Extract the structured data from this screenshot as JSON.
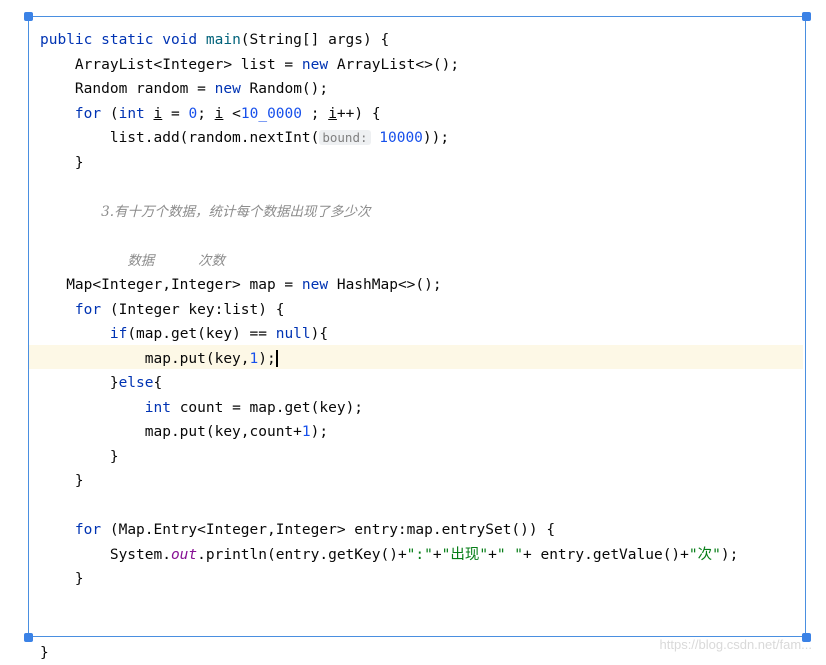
{
  "code": {
    "l01": {
      "t1": "public static void ",
      "t2": "main",
      "t3": "(String[] args) {"
    },
    "l02": {
      "t1": "    ArrayList<Integer> list = ",
      "t2": "new",
      " t3": "",
      "t3b": " ArrayList<>();"
    },
    "l03": {
      "t1": "    Random random = ",
      "t2": "new",
      "t3": " Random();"
    },
    "l04": {
      "t1": "    ",
      "t2": "for",
      "t3": " (",
      "t4": "int",
      " t5": "",
      "t5b": " ",
      "t6": "i",
      "t7": " = ",
      "t8": "0",
      "t9": "; ",
      "t10": "i",
      "t11": " <",
      "t12": "10_0000",
      "t13": " ; ",
      "t14": "i",
      "t15": "++) {"
    },
    "l05": {
      "t1": "        list.add(random.nextInt(",
      "hint": "bound:",
      "t2": " ",
      "t3": "10000",
      "t4": "));"
    },
    "l06": {
      "t1": "    }"
    },
    "l08": {
      "comment": "3.有十万个数据，统计每个数据出现了多少次"
    },
    "l10": {
      "c1": "数据",
      "c2": "次数"
    },
    "l11": {
      "t1": "   Map<Integer,Integer> map = ",
      "t2": "new",
      "t3": " HashMap<>();"
    },
    "l12": {
      "t1": "    ",
      "t2": "for",
      "t3": " (Integer key:list) {"
    },
    "l13": {
      "t1": "        ",
      "t2": "if",
      "t3": "(map.get(key) == ",
      "t4": "null",
      "t5": "){"
    },
    "l14": {
      "t1": "            map.put(key,",
      "t2": "1",
      "t3": ");"
    },
    "l15": {
      "t1": "        }",
      "t2": "else",
      "t3": "{"
    },
    "l16": {
      "t1": "            ",
      "t2": "int",
      "t3": " count = map.get(key);"
    },
    "l17": {
      "t1": "            map.put(key,count+",
      "t2": "1",
      "t3": ");"
    },
    "l18": {
      "t1": "        }"
    },
    "l19": {
      "t1": "    }"
    },
    "l21": {
      "t1": "    ",
      "t2": "for",
      "t3": " (Map.Entry<Integer,Integer> entry:map.entrySet()) {"
    },
    "l22": {
      "t1": "        System.",
      "t2": "out",
      "t3": ".println(entry.getKey()+",
      "t4": "\":\"",
      "t5": "+",
      "t6": "\"出现\"",
      "t7": "+",
      "t8": "\" \"",
      "t9": "+ entry.getValue()+",
      "t10": "\"次\"",
      "t11": ");"
    },
    "l23": {
      "t1": "    }"
    },
    "l26": {
      "t1": "}"
    }
  },
  "watermark": "https://blog.csdn.net/fam..."
}
